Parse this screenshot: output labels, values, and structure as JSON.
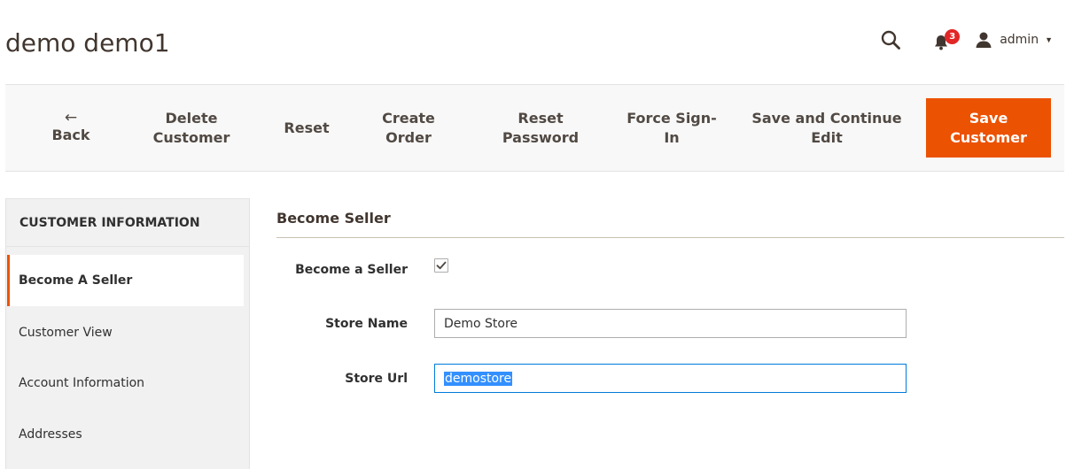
{
  "page": {
    "title": "demo demo1"
  },
  "header": {
    "notifications_count": "3",
    "user_label": "admin"
  },
  "toolbar": {
    "back_label": "Back",
    "delete_label_1": "Delete",
    "delete_label_2": "Customer",
    "reset_label": "Reset",
    "create_order_1": "Create",
    "create_order_2": "Order",
    "reset_password_1": "Reset",
    "reset_password_2": "Password",
    "force_signin_1": "Force Sign-",
    "force_signin_2": "In",
    "save_continue_1": "Save and Continue",
    "save_continue_2": "Edit",
    "save_customer_1": "Save",
    "save_customer_2": "Customer"
  },
  "sidebar": {
    "title": "CUSTOMER INFORMATION",
    "items": [
      {
        "label": "Become A Seller",
        "active": true
      },
      {
        "label": "Customer View"
      },
      {
        "label": "Account Information"
      },
      {
        "label": "Addresses"
      }
    ]
  },
  "form": {
    "section_title": "Become Seller",
    "become_seller_label": "Become a Seller",
    "become_seller_checked": true,
    "store_name_label": "Store Name",
    "store_name_value": "Demo Store",
    "store_url_label": "Store Url",
    "store_url_value": "demostore"
  },
  "colors": {
    "accent": "#eb5202",
    "badge": "#e22626",
    "focus": "#007bdb",
    "selection": "#3390ff"
  },
  "icons": [
    "search-icon",
    "bell-icon",
    "user-icon",
    "caret-down-icon",
    "arrow-left-icon",
    "checkmark-icon"
  ]
}
